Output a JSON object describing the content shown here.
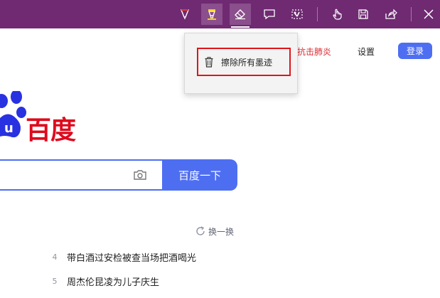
{
  "toolbar": {
    "background": "#6f2a72",
    "tools": [
      {
        "id": "ballpoint-pen",
        "icon": "pen-icon"
      },
      {
        "id": "highlighter",
        "icon": "highlighter-icon",
        "color": "#f6d100"
      },
      {
        "id": "eraser",
        "icon": "eraser-icon"
      },
      {
        "id": "add-note",
        "icon": "note-icon"
      },
      {
        "id": "clip",
        "icon": "clip-icon"
      },
      {
        "id": "touch-writing",
        "icon": "touch-icon"
      },
      {
        "id": "save",
        "icon": "save-icon"
      },
      {
        "id": "share",
        "icon": "share-icon"
      },
      {
        "id": "exit",
        "icon": "close-icon"
      }
    ]
  },
  "popup": {
    "clear_all_label": "擦除所有墨迹"
  },
  "header": {
    "links": {
      "covid": "抗击肺炎",
      "settings": "设置"
    },
    "login_label": "登录"
  },
  "logo": {
    "text": "百度",
    "color": "#de0a1e"
  },
  "search": {
    "button_label": "百度一下",
    "accent": "#4e6ef2"
  },
  "hotlist": {
    "refresh_label": "换一换",
    "items": [
      {
        "rank": "4",
        "title": "带白酒过安检被查当场把酒喝光"
      },
      {
        "rank": "5",
        "title": "周杰伦昆凌为儿子庆生"
      }
    ]
  }
}
